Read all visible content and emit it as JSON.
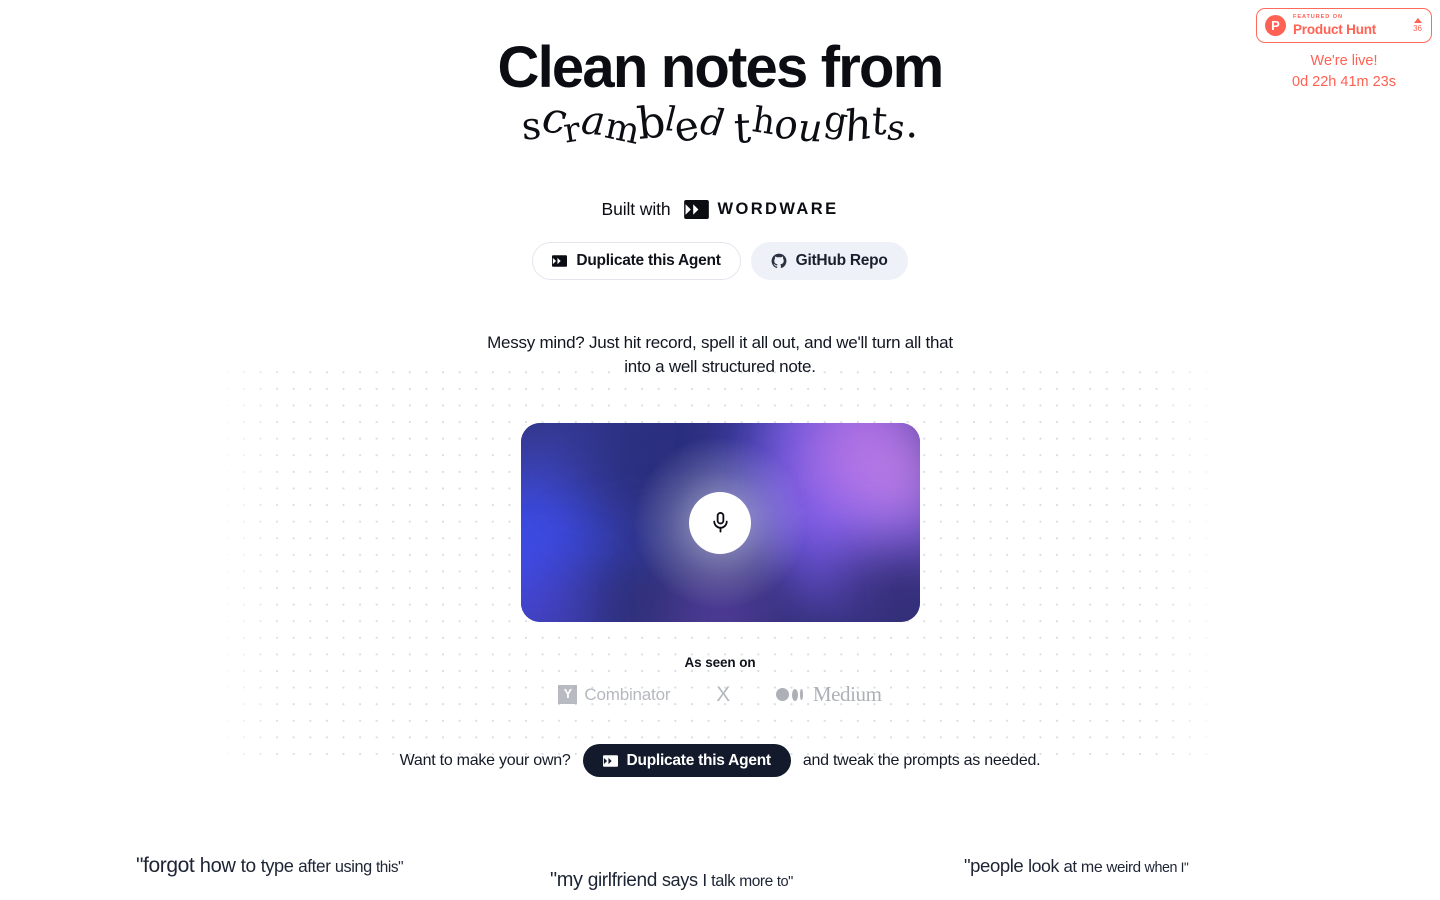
{
  "product_hunt": {
    "kicker": "FEATURED ON",
    "name": "Product Hunt",
    "votes": "36",
    "live_label": "We're live!",
    "timer": "0d 22h 41m 23s"
  },
  "hero": {
    "headline_line1": "Clean notes from",
    "headline_line2": "scrambled thoughts.",
    "built_with_label": "Built with",
    "brand_name": "WORDWARE",
    "tagline": "Messy mind? Just hit record, spell it all out, and we'll turn all that into a well structured note."
  },
  "buttons": {
    "duplicate": "Duplicate this Agent",
    "github": "GitHub Repo"
  },
  "recorder": {
    "mic_icon": "microphone-icon"
  },
  "as_seen_on": {
    "title": "As seen on",
    "logos": [
      {
        "mark": "Y",
        "label": "Combinator"
      },
      {
        "mark": "X",
        "label": ""
      },
      {
        "mark": "medium-dots",
        "label": "Medium"
      }
    ]
  },
  "cta": {
    "prefix": "Want to make your own?",
    "button": "Duplicate this Agent",
    "suffix": "and tweak the prompts as needed."
  },
  "testimonials": [
    {
      "text": "\"forgot how to type after using this\""
    },
    {
      "text": "\"my girlfriend says I talk more to\""
    },
    {
      "text": "\"people look at me weird when I\""
    }
  ],
  "colors": {
    "product_hunt": "#ff6154",
    "dark_button": "#131a2b",
    "grey_button": "#eef1f7",
    "text": "#10131c"
  }
}
